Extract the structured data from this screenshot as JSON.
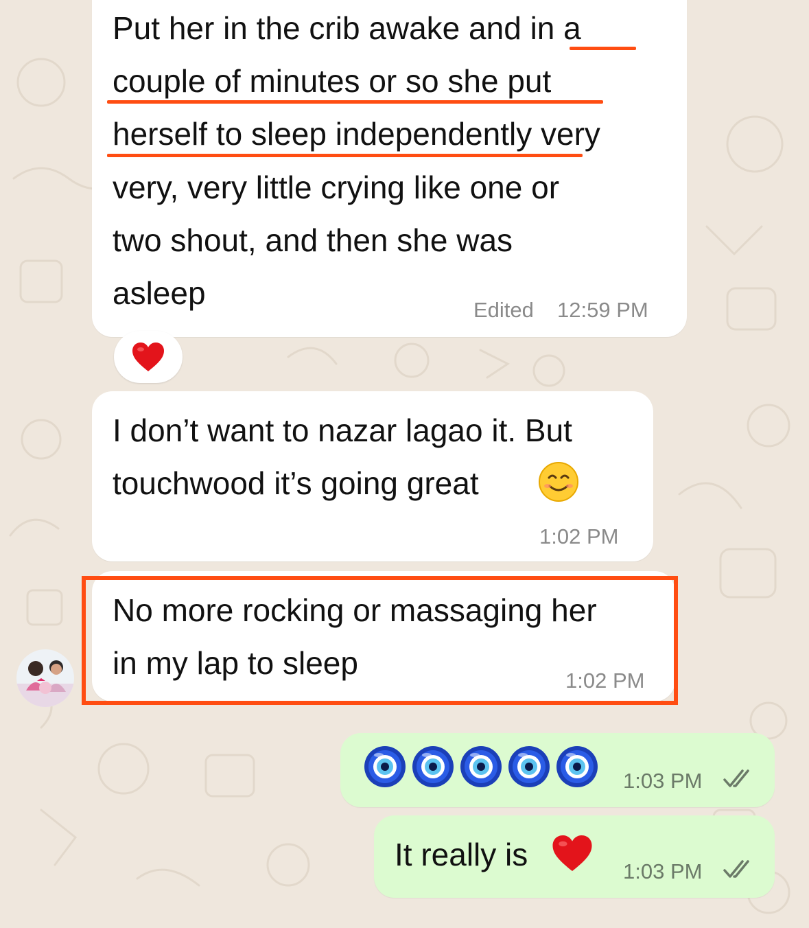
{
  "chat": {
    "messages": [
      {
        "direction": "incoming",
        "lines": [
          "Put her in the crib awake and in a",
          "couple of minutes or so she put",
          "herself to sleep independently very",
          "very, very little crying like one or",
          "two shout, and then she was",
          "asleep"
        ],
        "edited_label": "Edited",
        "time": "12:59 PM",
        "reaction": "heart"
      },
      {
        "direction": "incoming",
        "lines": [
          "I don’t want to nazar lagao it. But",
          "touchwood it’s going great"
        ],
        "emoji": "smiling-face",
        "time": "1:02 PM"
      },
      {
        "direction": "incoming",
        "lines": [
          "No more rocking or massaging her",
          "in my lap to sleep"
        ],
        "time": "1:02 PM",
        "highlighted": true
      },
      {
        "direction": "outgoing",
        "emoji": "nazar-amulet",
        "emoji_count": 5,
        "time": "1:03 PM",
        "status": "read"
      },
      {
        "direction": "outgoing",
        "lines": [
          "It really is"
        ],
        "emoji": "heart",
        "time": "1:03 PM",
        "status": "read"
      }
    ]
  },
  "colors": {
    "background": "#efe7dd",
    "incoming_bubble": "#ffffff",
    "outgoing_bubble": "#dcfbd0",
    "annotation": "#ff4d12"
  }
}
